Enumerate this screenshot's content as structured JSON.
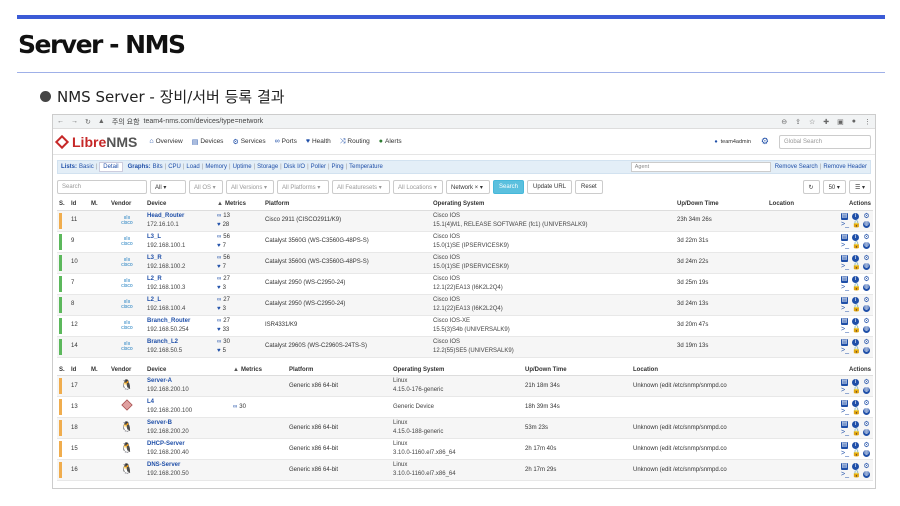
{
  "slide": {
    "title": "Server - NMS",
    "bullet": "NMS Server - 장비/서버 등록 결과"
  },
  "browser": {
    "security_label": "주의 요함",
    "url": "team4-nms.com/devices/type=network"
  },
  "nav": {
    "logo_libre": "Libre",
    "logo_nms": "NMS",
    "items": [
      "Overview",
      "Devices",
      "Services",
      "Ports",
      "Health",
      "Routing",
      "Alerts"
    ],
    "user": "team4admin",
    "global_search_placeholder": "Global Search"
  },
  "lists_bar": {
    "lists_label": "Lists:",
    "basic": "Basic",
    "detail": "Detail",
    "graphs_label": "Graphs:",
    "graphs": [
      "Bits",
      "CPU",
      "Load",
      "Memory",
      "Uptime",
      "Storage",
      "Disk I/O",
      "Poller",
      "Ping",
      "Temperature"
    ],
    "agent_placeholder": "Agent",
    "remove_search": "Remove Search",
    "remove_header": "Remove Header"
  },
  "filters": {
    "search_placeholder": "Search",
    "all": "All",
    "all_os": "All OS",
    "all_versions": "All Versions",
    "all_platforms": "All Platforms",
    "all_featuresets": "All Featuresets",
    "all_locations": "All Locations",
    "network": "Network",
    "search_button": "Search",
    "update_url": "Update URL",
    "reset": "Reset",
    "per_page": "50"
  },
  "table1": {
    "headers": [
      "S.",
      "Id",
      "M.",
      "Vendor",
      "Device",
      "Metrics",
      "Platform",
      "Operating System",
      "Up/Down Time",
      "Location",
      "Actions"
    ],
    "vendor_label": "cisco",
    "rows": [
      {
        "id": "11",
        "name": "Head_Router",
        "ip": "172.16.10.1",
        "ports": "13",
        "health": "28",
        "platform": "Cisco 2911 (CISCO2911/K9)",
        "os": "Cisco IOS",
        "os_ver": "15.1(4)M1, RELEASE SOFTWARE (fc1) (UNIVERSALK9)",
        "uptime": "23h 34m 26s"
      },
      {
        "id": "9",
        "name": "L3_L",
        "ip": "192.168.100.1",
        "ports": "56",
        "health": "7",
        "platform": "Catalyst 3560G (WS-C3560G-48PS-S)",
        "os": "Cisco IOS",
        "os_ver": "15.0(1)SE (IPSERVICESK9)",
        "uptime": "3d 22m 31s"
      },
      {
        "id": "10",
        "name": "L3_R",
        "ip": "192.168.100.2",
        "ports": "56",
        "health": "7",
        "platform": "Catalyst 3560G (WS-C3560G-48PS-S)",
        "os": "Cisco IOS",
        "os_ver": "15.0(1)SE (IPSERVICESK9)",
        "uptime": "3d 24m 22s"
      },
      {
        "id": "7",
        "name": "L2_R",
        "ip": "192.168.100.3",
        "ports": "27",
        "health": "3",
        "platform": "Catalyst 2950 (WS-C2950-24)",
        "os": "Cisco IOS",
        "os_ver": "12.1(22)EA13 (I6K2L2Q4)",
        "uptime": "3d 25m 19s"
      },
      {
        "id": "8",
        "name": "L2_L",
        "ip": "192.168.100.4",
        "ports": "27",
        "health": "3",
        "platform": "Catalyst 2950 (WS-C2950-24)",
        "os": "Cisco IOS",
        "os_ver": "12.1(22)EA13 (I6K2L2Q4)",
        "uptime": "3d 24m 13s"
      },
      {
        "id": "12",
        "name": "Branch_Router",
        "ip": "192.168.50.254",
        "ports": "27",
        "health": "33",
        "platform": "ISR4331/K9",
        "os": "Cisco IOS-XE",
        "os_ver": "15.5(3)S4b (UNIVERSALK9)",
        "uptime": "3d 20m 47s"
      },
      {
        "id": "14",
        "name": "Branch_L2",
        "ip": "192.168.50.5",
        "ports": "30",
        "health": "5",
        "platform": "Catalyst 2960S (WS-C2960S-24TS-S)",
        "os": "Cisco IOS",
        "os_ver": "12.2(55)SE5 (UNIVERSALK9)",
        "uptime": "3d 19m 13s"
      }
    ]
  },
  "table2": {
    "headers": [
      "S.",
      "Id",
      "M.",
      "Vendor",
      "Device",
      "Metrics",
      "Platform",
      "Operating System",
      "Up/Down Time",
      "Location",
      "Actions"
    ],
    "rows": [
      {
        "id": "17",
        "vendor": "tux",
        "name": "Server-A",
        "ip": "192.168.200.10",
        "ports": "",
        "platform": "Generic x86 64-bit",
        "os": "Linux",
        "os_ver": "4.15.0-176-generic",
        "uptime": "21h 18m 34s",
        "location": "Unknown (edit /etc/snmp/snmpd.co"
      },
      {
        "id": "13",
        "vendor": "cube",
        "name": "L4",
        "ip": "192.168.200.100",
        "ports": "30",
        "platform": "",
        "os": "Generic Device",
        "os_ver": "",
        "uptime": "18h 39m 34s",
        "location": ""
      },
      {
        "id": "18",
        "vendor": "tux",
        "name": "Server-B",
        "ip": "192.168.200.20",
        "ports": "",
        "platform": "Generic x86 64-bit",
        "os": "Linux",
        "os_ver": "4.15.0-188-generic",
        "uptime": "53m 23s",
        "location": "Unknown (edit /etc/snmp/snmpd.co"
      },
      {
        "id": "15",
        "vendor": "tux",
        "name": "DHCP-Server",
        "ip": "192.168.200.40",
        "ports": "",
        "platform": "Generic x86 64-bit",
        "os": "Linux",
        "os_ver": "3.10.0-1160.el7.x86_64",
        "uptime": "2h 17m 40s",
        "location": "Unknown (edit /etc/snmp/snmpd.co"
      },
      {
        "id": "16",
        "vendor": "tux",
        "name": "DNS-Server",
        "ip": "192.168.200.50",
        "ports": "",
        "platform": "Generic x86 64-bit",
        "os": "Linux",
        "os_ver": "3.10.0-1160.el7.x86_64",
        "uptime": "2h 17m 29s",
        "location": "Unknown (edit /etc/snmp/snmpd.co"
      }
    ]
  },
  "colors": {
    "status_up": "#5cb85c",
    "status_warn": "#f0ad4e",
    "accent": "#1f4fa8",
    "search_btn": "#5bc0de"
  }
}
